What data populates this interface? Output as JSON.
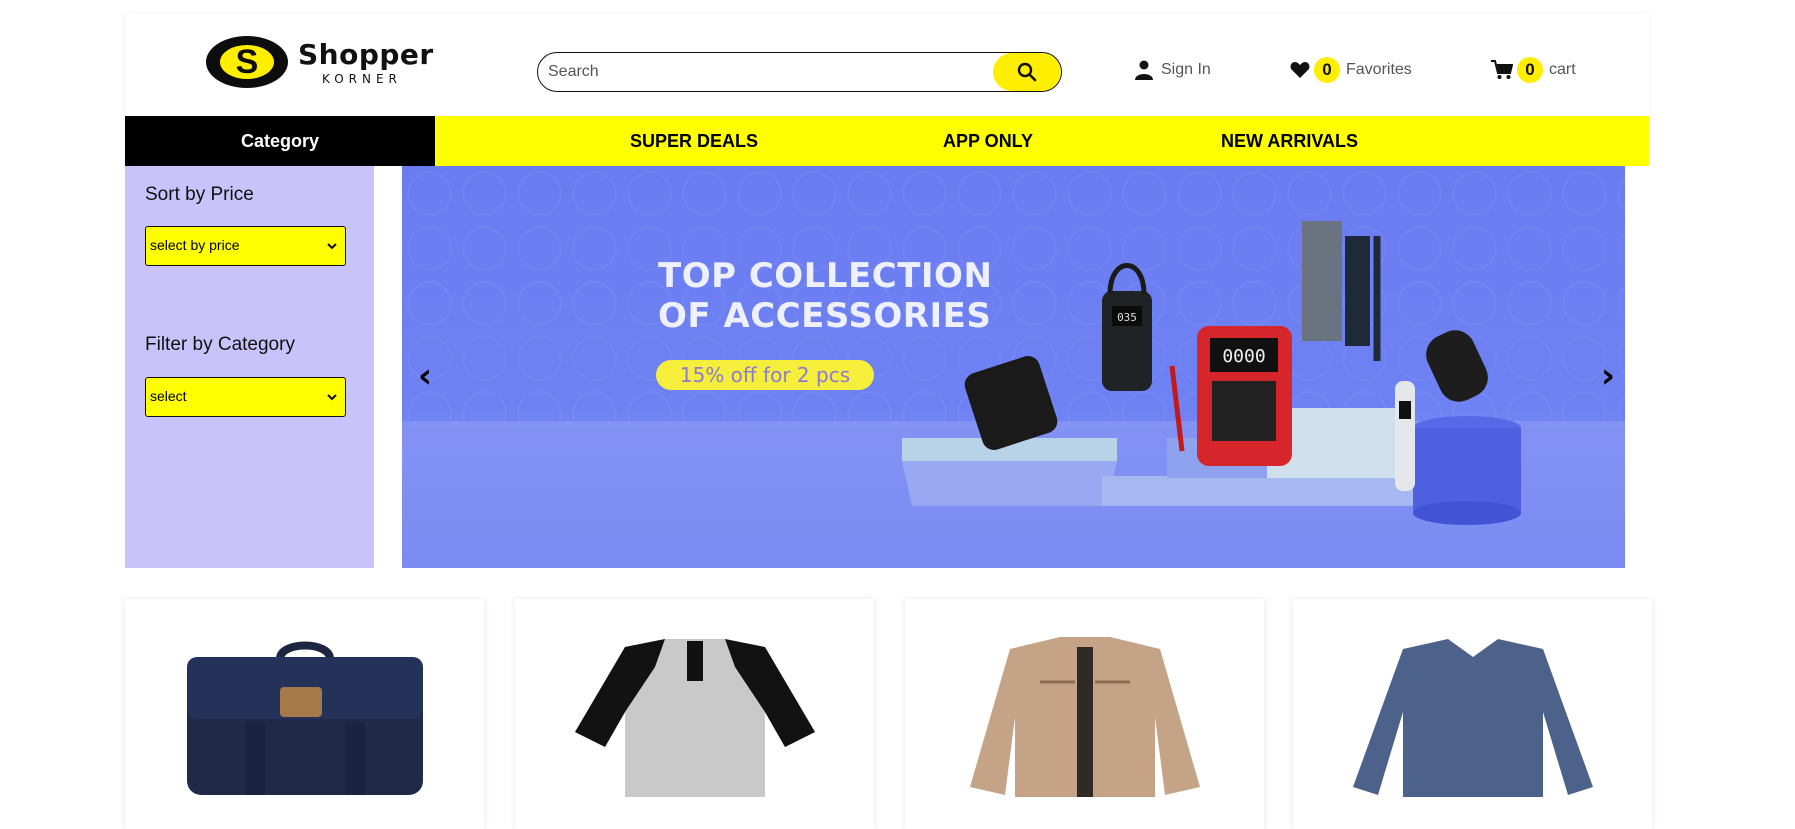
{
  "header": {
    "logo": {
      "mark_letter": "S",
      "word": "Shopper",
      "sub": "KORNER"
    },
    "search": {
      "placeholder": "Search",
      "value": ""
    },
    "sign_in_label": "Sign In",
    "favorites": {
      "count": "0",
      "label": "Favorites"
    },
    "cart": {
      "count": "0",
      "label": "cart"
    }
  },
  "nav": {
    "category_label": "Category",
    "links": [
      "SUPER DEALS",
      "APP ONLY",
      "NEW ARRIVALS"
    ]
  },
  "filters": {
    "sort_title": "Sort by Price",
    "sort_select": "select by price",
    "category_title": "Filter by Category",
    "category_select": "select"
  },
  "banner": {
    "headline_line1": "TOP COLLECTION",
    "headline_line2": "OF ACCESSORIES",
    "promo": "15% off for 2 pcs",
    "prev": "‹",
    "next": "›",
    "multimeter_reading": "0000",
    "pump_reading": "035"
  },
  "colors": {
    "accent_yellow": "#ffff00",
    "nav_black": "#000000",
    "filter_panel": "#c8c4fb",
    "banner_blue": "#6f82f3"
  },
  "icons": {
    "search": "search-icon",
    "user": "user-icon",
    "heart": "heart-icon",
    "cart": "cart-icon",
    "chevron": "chevron-down-icon"
  },
  "products": [
    {
      "image": "navy-messenger-bag"
    },
    {
      "image": "raglan-henley-shirt"
    },
    {
      "image": "khaki-jacket"
    },
    {
      "image": "blue-long-sleeve-shirt"
    }
  ]
}
